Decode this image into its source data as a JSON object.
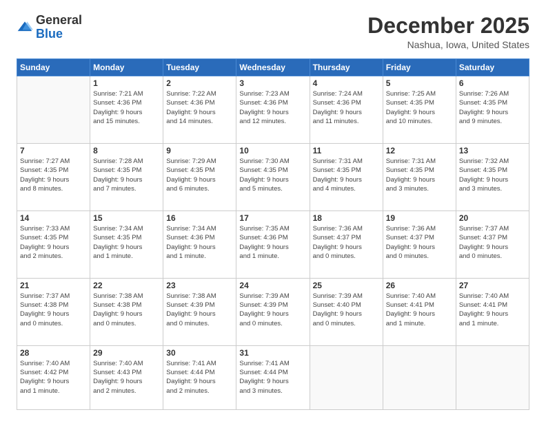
{
  "logo": {
    "general": "General",
    "blue": "Blue"
  },
  "header": {
    "month": "December 2025",
    "location": "Nashua, Iowa, United States"
  },
  "days_of_week": [
    "Sunday",
    "Monday",
    "Tuesday",
    "Wednesday",
    "Thursday",
    "Friday",
    "Saturday"
  ],
  "weeks": [
    [
      {
        "day": "",
        "info": ""
      },
      {
        "day": "1",
        "info": "Sunrise: 7:21 AM\nSunset: 4:36 PM\nDaylight: 9 hours\nand 15 minutes."
      },
      {
        "day": "2",
        "info": "Sunrise: 7:22 AM\nSunset: 4:36 PM\nDaylight: 9 hours\nand 14 minutes."
      },
      {
        "day": "3",
        "info": "Sunrise: 7:23 AM\nSunset: 4:36 PM\nDaylight: 9 hours\nand 12 minutes."
      },
      {
        "day": "4",
        "info": "Sunrise: 7:24 AM\nSunset: 4:36 PM\nDaylight: 9 hours\nand 11 minutes."
      },
      {
        "day": "5",
        "info": "Sunrise: 7:25 AM\nSunset: 4:35 PM\nDaylight: 9 hours\nand 10 minutes."
      },
      {
        "day": "6",
        "info": "Sunrise: 7:26 AM\nSunset: 4:35 PM\nDaylight: 9 hours\nand 9 minutes."
      }
    ],
    [
      {
        "day": "7",
        "info": "Sunrise: 7:27 AM\nSunset: 4:35 PM\nDaylight: 9 hours\nand 8 minutes."
      },
      {
        "day": "8",
        "info": "Sunrise: 7:28 AM\nSunset: 4:35 PM\nDaylight: 9 hours\nand 7 minutes."
      },
      {
        "day": "9",
        "info": "Sunrise: 7:29 AM\nSunset: 4:35 PM\nDaylight: 9 hours\nand 6 minutes."
      },
      {
        "day": "10",
        "info": "Sunrise: 7:30 AM\nSunset: 4:35 PM\nDaylight: 9 hours\nand 5 minutes."
      },
      {
        "day": "11",
        "info": "Sunrise: 7:31 AM\nSunset: 4:35 PM\nDaylight: 9 hours\nand 4 minutes."
      },
      {
        "day": "12",
        "info": "Sunrise: 7:31 AM\nSunset: 4:35 PM\nDaylight: 9 hours\nand 3 minutes."
      },
      {
        "day": "13",
        "info": "Sunrise: 7:32 AM\nSunset: 4:35 PM\nDaylight: 9 hours\nand 3 minutes."
      }
    ],
    [
      {
        "day": "14",
        "info": "Sunrise: 7:33 AM\nSunset: 4:35 PM\nDaylight: 9 hours\nand 2 minutes."
      },
      {
        "day": "15",
        "info": "Sunrise: 7:34 AM\nSunset: 4:35 PM\nDaylight: 9 hours\nand 1 minute."
      },
      {
        "day": "16",
        "info": "Sunrise: 7:34 AM\nSunset: 4:36 PM\nDaylight: 9 hours\nand 1 minute."
      },
      {
        "day": "17",
        "info": "Sunrise: 7:35 AM\nSunset: 4:36 PM\nDaylight: 9 hours\nand 1 minute."
      },
      {
        "day": "18",
        "info": "Sunrise: 7:36 AM\nSunset: 4:37 PM\nDaylight: 9 hours\nand 0 minutes."
      },
      {
        "day": "19",
        "info": "Sunrise: 7:36 AM\nSunset: 4:37 PM\nDaylight: 9 hours\nand 0 minutes."
      },
      {
        "day": "20",
        "info": "Sunrise: 7:37 AM\nSunset: 4:37 PM\nDaylight: 9 hours\nand 0 minutes."
      }
    ],
    [
      {
        "day": "21",
        "info": "Sunrise: 7:37 AM\nSunset: 4:38 PM\nDaylight: 9 hours\nand 0 minutes."
      },
      {
        "day": "22",
        "info": "Sunrise: 7:38 AM\nSunset: 4:38 PM\nDaylight: 9 hours\nand 0 minutes."
      },
      {
        "day": "23",
        "info": "Sunrise: 7:38 AM\nSunset: 4:39 PM\nDaylight: 9 hours\nand 0 minutes."
      },
      {
        "day": "24",
        "info": "Sunrise: 7:39 AM\nSunset: 4:39 PM\nDaylight: 9 hours\nand 0 minutes."
      },
      {
        "day": "25",
        "info": "Sunrise: 7:39 AM\nSunset: 4:40 PM\nDaylight: 9 hours\nand 0 minutes."
      },
      {
        "day": "26",
        "info": "Sunrise: 7:40 AM\nSunset: 4:41 PM\nDaylight: 9 hours\nand 1 minute."
      },
      {
        "day": "27",
        "info": "Sunrise: 7:40 AM\nSunset: 4:41 PM\nDaylight: 9 hours\nand 1 minute."
      }
    ],
    [
      {
        "day": "28",
        "info": "Sunrise: 7:40 AM\nSunset: 4:42 PM\nDaylight: 9 hours\nand 1 minute."
      },
      {
        "day": "29",
        "info": "Sunrise: 7:40 AM\nSunset: 4:43 PM\nDaylight: 9 hours\nand 2 minutes."
      },
      {
        "day": "30",
        "info": "Sunrise: 7:41 AM\nSunset: 4:44 PM\nDaylight: 9 hours\nand 2 minutes."
      },
      {
        "day": "31",
        "info": "Sunrise: 7:41 AM\nSunset: 4:44 PM\nDaylight: 9 hours\nand 3 minutes."
      },
      {
        "day": "",
        "info": ""
      },
      {
        "day": "",
        "info": ""
      },
      {
        "day": "",
        "info": ""
      }
    ]
  ]
}
